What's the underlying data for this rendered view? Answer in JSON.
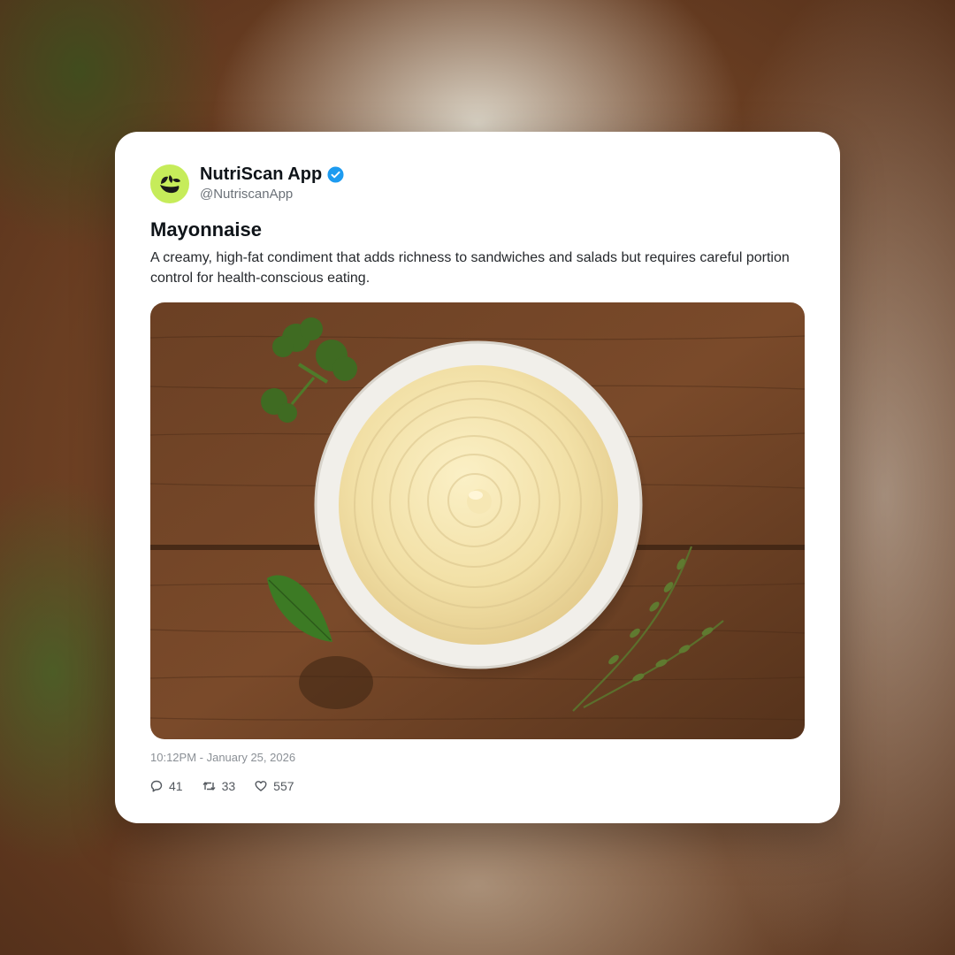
{
  "post": {
    "author": {
      "display_name": "NutriScan App",
      "handle": "@NutriscanApp",
      "verified": true,
      "avatar_icon": "leaf-logo-icon",
      "avatar_color": "#c6ec5a"
    },
    "title": "Mayonnaise",
    "description": "A creamy, high-fat condiment that adds richness to sandwiches and salads but requires careful portion control for health-conscious eating.",
    "image_icon": "mayonnaise-bowl-photo",
    "timestamp": "10:12PM - January 25, 2026",
    "stats": {
      "replies": "41",
      "retweets": "33",
      "likes": "557"
    }
  },
  "colors": {
    "verified_badge": "#1d9bf0",
    "card_background": "#ffffff",
    "text_primary": "#0f1419",
    "text_secondary": "#6b7178"
  }
}
